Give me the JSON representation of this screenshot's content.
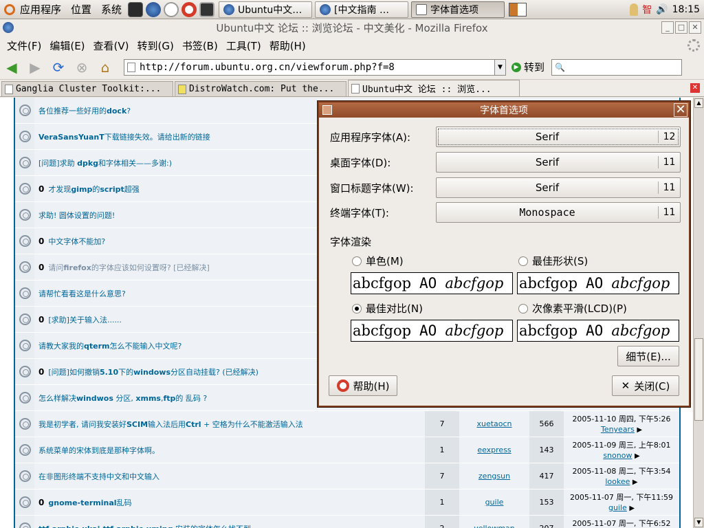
{
  "panel": {
    "menus": [
      "应用程序",
      "位置",
      "系统"
    ],
    "tasks": [
      {
        "label": "Ubuntu中文…",
        "active": false
      },
      {
        "label": "[中文指南 …",
        "active": false
      },
      {
        "label": "字体首选项",
        "active": true
      }
    ],
    "clock": "18:15",
    "input_method": "智",
    "volume": "🔊"
  },
  "window": {
    "title": "Ubuntu中文 论坛 :: 浏览论坛 - 中文美化 - Mozilla Firefox",
    "menus": [
      "文件(F)",
      "编辑(E)",
      "查看(V)",
      "转到(G)",
      "书签(B)",
      "工具(T)",
      "帮助(H)"
    ],
    "url": "http://forum.ubuntu.org.cn/viewforum.php?f=8",
    "go_label": "转到",
    "tabs": [
      {
        "label": "Ganglia Cluster Toolkit:...",
        "active": false
      },
      {
        "label": "DistroWatch.com: Put the...",
        "active": false
      },
      {
        "label": "Ubuntu中文 论坛 :: 浏览...",
        "active": true
      }
    ]
  },
  "threads": [
    {
      "pin": "",
      "html_title": "各位推荐一些好用的<b>dock</b>?",
      "dim": false,
      "replies": "",
      "author": "",
      "views": "",
      "last_date": "",
      "last_user": ""
    },
    {
      "pin": "",
      "html_title": "<b>VeraSansYuanT</b>下载链接失效。请给出新的链接",
      "dim": false,
      "replies": "",
      "author": "",
      "views": "",
      "last_date": "",
      "last_user": ""
    },
    {
      "pin": "",
      "html_title": "[问题]求助 <b>dpkg</b>和字体相关——多谢:)",
      "dim": false,
      "replies": "",
      "author": "",
      "views": "",
      "last_date": "",
      "last_user": ""
    },
    {
      "pin": "0",
      "html_title": "才发现<b>gimp</b>的<b>script</b>超强",
      "dim": false,
      "replies": "",
      "author": "",
      "views": "",
      "last_date": "",
      "last_user": ""
    },
    {
      "pin": "",
      "html_title": "求助! 圆体设置的问题!",
      "dim": false,
      "replies": "",
      "author": "",
      "views": "",
      "last_date": "",
      "last_user": ""
    },
    {
      "pin": "0",
      "html_title": "中文字体不能加?",
      "dim": false,
      "replies": "",
      "author": "",
      "views": "",
      "last_date": "",
      "last_user": ""
    },
    {
      "pin": "0",
      "html_title": "请问<b>firefox</b>的字体应该如何设置呀? [已经解决]",
      "dim": true,
      "replies": "",
      "author": "",
      "views": "",
      "last_date": "",
      "last_user": ""
    },
    {
      "pin": "",
      "html_title": "请帮忙看看这是什么意思?",
      "dim": false,
      "replies": "",
      "author": "",
      "views": "",
      "last_date": "",
      "last_user": ""
    },
    {
      "pin": "0",
      "html_title": "[求助]关于输入法......",
      "dim": false,
      "replies": "",
      "author": "",
      "views": "",
      "last_date": "",
      "last_user": ""
    },
    {
      "pin": "",
      "html_title": "请教大家我的<b>qterm</b>怎么不能输入中文呢?",
      "dim": false,
      "replies": "",
      "author": "",
      "views": "",
      "last_date": "",
      "last_user": ""
    },
    {
      "pin": "0",
      "html_title": "[问题]如何撤销<b>5.10</b>下的<b>windows</b>分区自动挂载? (已经解决)",
      "dim": false,
      "replies": "",
      "author": "",
      "views": "",
      "last_date": "",
      "last_user": ""
    },
    {
      "pin": "",
      "html_title": "怎么样解决<b>windwos</b> 分区, <b>xmms</b>,<b>ftp</b>的 乱码 ?",
      "dim": false,
      "replies": "",
      "author": "",
      "views": "",
      "last_date": "",
      "last_user": ""
    },
    {
      "pin": "",
      "html_title": "我是初学者, 请问我安装好<b>SCIM</b>输入法后用<b>Ctrl</b> + 空格为什么不能激活输入法",
      "dim": false,
      "replies": "7",
      "author": "xuetaocn",
      "views": "566",
      "last_date": "2005-11-10 周四, 下午5:26",
      "last_user": "Tenyears"
    },
    {
      "pin": "",
      "html_title": "系统菜单的宋体到底是那种字体啊。",
      "dim": false,
      "replies": "1",
      "author": "eexpress",
      "views": "143",
      "last_date": "2005-11-09 周三, 上午8:01",
      "last_user": "snonow"
    },
    {
      "pin": "",
      "html_title": "在非图形终端不支持中文和中文输入",
      "dim": false,
      "replies": "7",
      "author": "zengsun",
      "views": "417",
      "last_date": "2005-11-08 周二, 下午3:54",
      "last_user": "lookee"
    },
    {
      "pin": "0",
      "html_title": "<b>gnome-terminal</b>乱码",
      "dim": false,
      "replies": "1",
      "author": "guile",
      "views": "153",
      "last_date": "2005-11-07 周一, 下午11:59",
      "last_user": "guile"
    },
    {
      "pin": "",
      "html_title": "<b>ttf-arphic-ukai,ttf-arphic-uming</b> 安装的字体怎么找不到",
      "dim": false,
      "replies": "2",
      "author": "yellowman",
      "views": "207",
      "last_date": "2005-11-07 周一, 下午6:52",
      "last_user": ""
    }
  ],
  "dialog": {
    "title": "字体首选项",
    "fonts": [
      {
        "label": "应用程序字体(A):",
        "name": "Serif",
        "size": "12"
      },
      {
        "label": "桌面字体(D):",
        "name": "Serif",
        "size": "11"
      },
      {
        "label": "窗口标题字体(W):",
        "name": "Serif",
        "size": "11"
      },
      {
        "label": "终端字体(T):",
        "name": "Monospace",
        "size": "11"
      }
    ],
    "render_label": "字体渲染",
    "options": [
      {
        "label": "单色(M)",
        "selected": false
      },
      {
        "label": "最佳形状(S)",
        "selected": false
      },
      {
        "label": "最佳对比(N)",
        "selected": true
      },
      {
        "label": "次像素平滑(LCD)(P)",
        "selected": false
      }
    ],
    "sample": {
      "a": "abcfgop",
      "b": "AO",
      "c": "abcfgop"
    },
    "details_label": "细节(E)...",
    "help_label": "帮助(H)",
    "close_label": "关闭(C)"
  }
}
